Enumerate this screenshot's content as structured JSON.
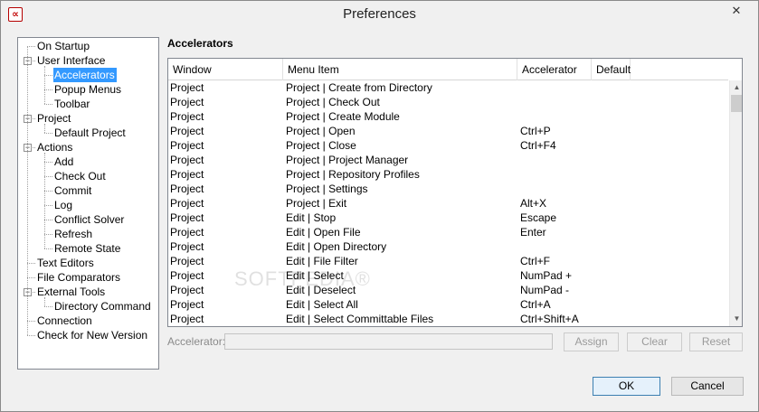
{
  "window": {
    "title": "Preferences",
    "close_glyph": "✕",
    "app_icon_glyph": "∝"
  },
  "tree": [
    {
      "label": "On Startup",
      "depth": 0,
      "expander": ""
    },
    {
      "label": "User Interface",
      "depth": 0,
      "expander": "−"
    },
    {
      "label": "Accelerators",
      "depth": 1,
      "expander": "",
      "selected": true
    },
    {
      "label": "Popup Menus",
      "depth": 1,
      "expander": ""
    },
    {
      "label": "Toolbar",
      "depth": 1,
      "expander": ""
    },
    {
      "label": "Project",
      "depth": 0,
      "expander": "−"
    },
    {
      "label": "Default Project",
      "depth": 1,
      "expander": ""
    },
    {
      "label": "Actions",
      "depth": 0,
      "expander": "−"
    },
    {
      "label": "Add",
      "depth": 1,
      "expander": ""
    },
    {
      "label": "Check Out",
      "depth": 1,
      "expander": ""
    },
    {
      "label": "Commit",
      "depth": 1,
      "expander": ""
    },
    {
      "label": "Log",
      "depth": 1,
      "expander": ""
    },
    {
      "label": "Conflict Solver",
      "depth": 1,
      "expander": ""
    },
    {
      "label": "Refresh",
      "depth": 1,
      "expander": ""
    },
    {
      "label": "Remote State",
      "depth": 1,
      "expander": ""
    },
    {
      "label": "Text Editors",
      "depth": 0,
      "expander": ""
    },
    {
      "label": "File Comparators",
      "depth": 0,
      "expander": ""
    },
    {
      "label": "External Tools",
      "depth": 0,
      "expander": "−"
    },
    {
      "label": "Directory Command",
      "depth": 1,
      "expander": ""
    },
    {
      "label": "Connection",
      "depth": 0,
      "expander": ""
    },
    {
      "label": "Check for New Version",
      "depth": 0,
      "expander": ""
    }
  ],
  "main": {
    "section_title": "Accelerators",
    "columns": [
      "Window",
      "Menu Item",
      "Accelerator",
      "Default"
    ],
    "rows": [
      [
        "Project",
        "Project | Create from Directory",
        "",
        ""
      ],
      [
        "Project",
        "Project | Check Out",
        "",
        ""
      ],
      [
        "Project",
        "Project | Create Module",
        "",
        ""
      ],
      [
        "Project",
        "Project | Open",
        "Ctrl+P",
        ""
      ],
      [
        "Project",
        "Project | Close",
        "Ctrl+F4",
        ""
      ],
      [
        "Project",
        "Project | Project Manager",
        "",
        ""
      ],
      [
        "Project",
        "Project | Repository Profiles",
        "",
        ""
      ],
      [
        "Project",
        "Project | Settings",
        "",
        ""
      ],
      [
        "Project",
        "Project | Exit",
        "Alt+X",
        ""
      ],
      [
        "Project",
        "Edit | Stop",
        "Escape",
        ""
      ],
      [
        "Project",
        "Edit | Open File",
        "Enter",
        ""
      ],
      [
        "Project",
        "Edit | Open Directory",
        "",
        ""
      ],
      [
        "Project",
        "Edit | File Filter",
        "Ctrl+F",
        ""
      ],
      [
        "Project",
        "Edit | Select",
        "NumPad +",
        ""
      ],
      [
        "Project",
        "Edit | Deselect",
        "NumPad -",
        ""
      ],
      [
        "Project",
        "Edit | Select All",
        "Ctrl+A",
        ""
      ],
      [
        "Project",
        "Edit | Select Committable Files",
        "Ctrl+Shift+A",
        ""
      ]
    ],
    "scroll_up_glyph": "▲",
    "scroll_down_glyph": "▼"
  },
  "accelerator_field": {
    "label": "Accelerator:",
    "value": ""
  },
  "buttons": {
    "assign": "Assign",
    "clear": "Clear",
    "reset": "Reset",
    "ok": "OK",
    "cancel": "Cancel"
  },
  "watermark": "SOFTPEDIA®"
}
